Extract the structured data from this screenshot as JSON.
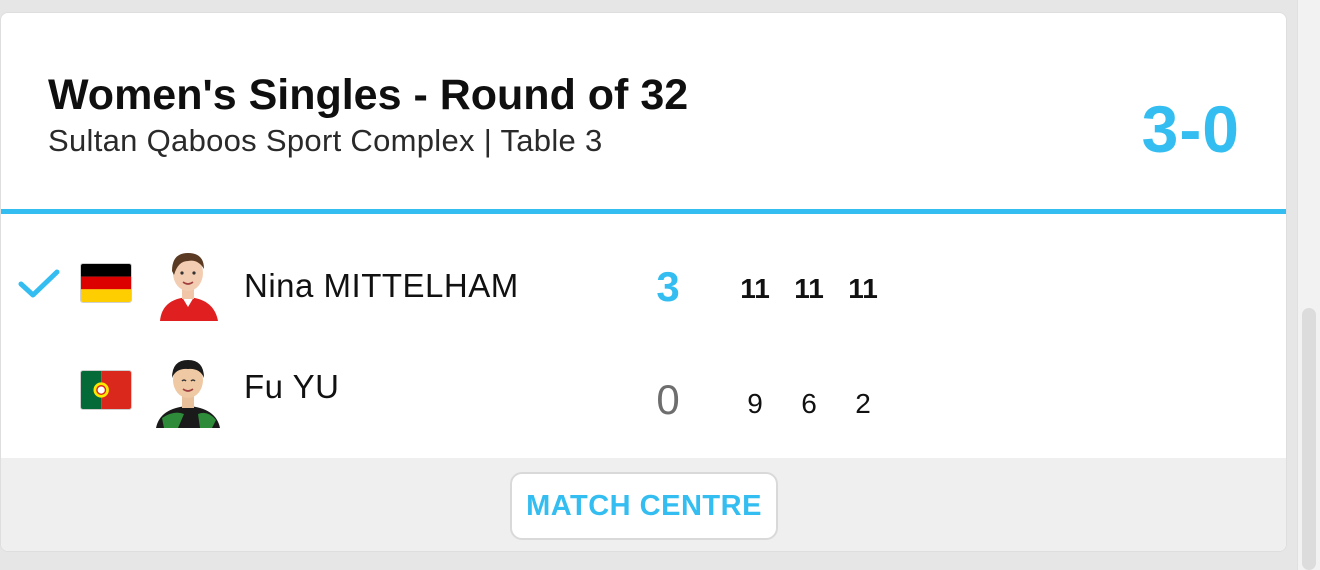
{
  "match": {
    "title": "Women's Singles - Round of 32",
    "venue": "Sultan Qaboos Sport Complex | Table 3",
    "score": "3-0"
  },
  "players": [
    {
      "name": "Nina MITTELHAM",
      "flag_icon": "germany-flag-icon",
      "winner": true,
      "sets": "3",
      "games": [
        "11",
        "11",
        "11"
      ]
    },
    {
      "name": "Fu YU",
      "flag_icon": "portugal-flag-icon",
      "winner": false,
      "sets": "0",
      "games": [
        "9",
        "6",
        "2"
      ]
    }
  ],
  "footer": {
    "button_label": "MATCH CENTRE"
  },
  "colors": {
    "accent": "#33bdf0",
    "loser_sets": "#6e6e6e",
    "footer_bg": "#efefef"
  }
}
